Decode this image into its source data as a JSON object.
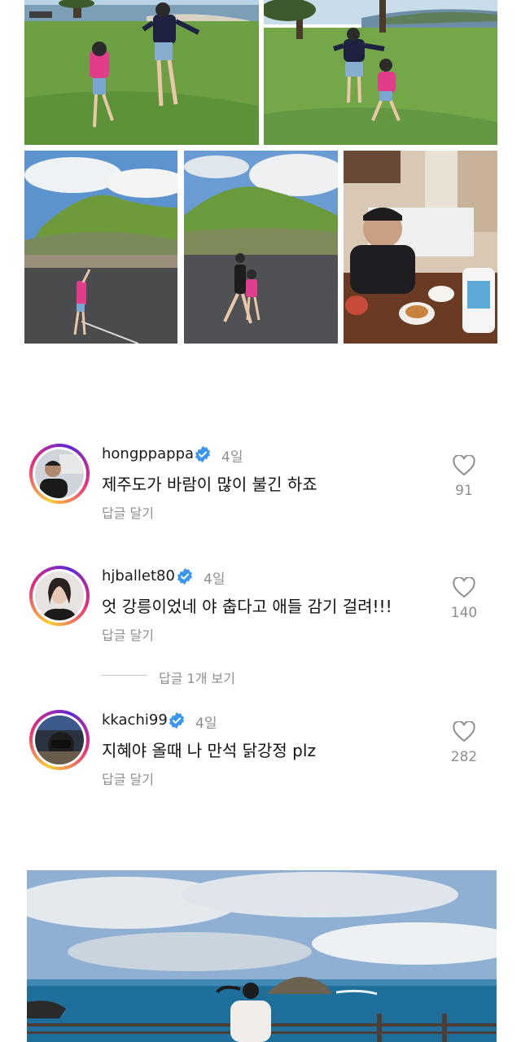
{
  "photos": [
    {
      "name": "photo-park-1"
    },
    {
      "name": "photo-park-2"
    },
    {
      "name": "photo-mountain-1"
    },
    {
      "name": "photo-mountain-2"
    },
    {
      "name": "photo-dinner"
    },
    {
      "name": "photo-ocean"
    }
  ],
  "comments": [
    {
      "username": "hongppappa",
      "verified": true,
      "time": "4일",
      "text": "제주도가 바람이 많이 불긴 하죠",
      "reply_label": "답글 달기",
      "likes": "91"
    },
    {
      "username": "hjballet80",
      "verified": true,
      "time": "4일",
      "text": "엇 강릉이었네 야 춥다고 애들 감기 걸려!!!",
      "reply_label": "답글 달기",
      "likes": "140"
    },
    {
      "username": "kkachi99",
      "verified": true,
      "time": "4일",
      "text": "지혜야 올때 나 만석 닭강정 plz",
      "reply_label": "답글 달기",
      "likes": "282"
    }
  ],
  "view_replies_label": "답글 1개 보기",
  "icons": {
    "verified": "verified-badge-icon",
    "like": "heart-icon"
  },
  "colors": {
    "verified_blue": "#3897f0",
    "muted_text": "#8e8e8e"
  }
}
